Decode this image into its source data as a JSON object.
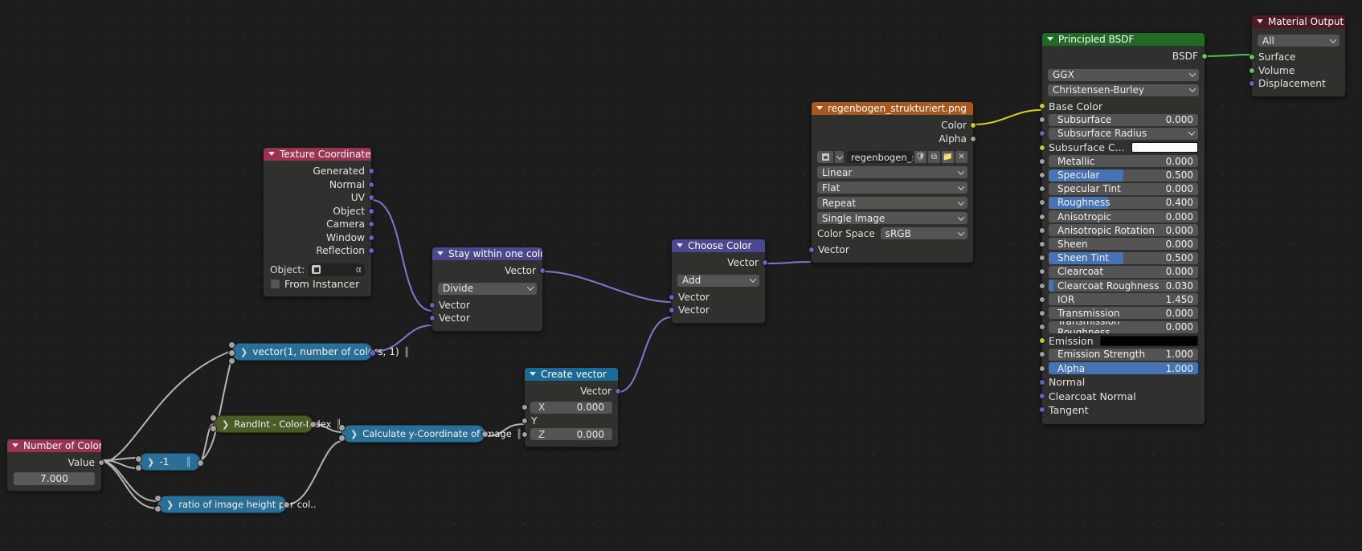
{
  "editor": {
    "name": "blender-shader-node-editor"
  },
  "nodes": {
    "texture_coordinate": {
      "title": "Texture Coordinate",
      "outputs": [
        "Generated",
        "Normal",
        "UV",
        "Object",
        "Camera",
        "Window",
        "Reflection"
      ],
      "object_label": "Object:",
      "object_value": "",
      "from_instancer_label": "From Instancer"
    },
    "stay_within_one_color": {
      "title": "Stay within one color",
      "output": "Vector",
      "operation": "Divide",
      "inputs": [
        "Vector",
        "Vector"
      ]
    },
    "choose_color": {
      "title": "Choose Color",
      "output": "Vector",
      "operation": "Add",
      "inputs": [
        "Vector",
        "Vector"
      ]
    },
    "create_vector": {
      "title": "Create vector",
      "output": "Vector",
      "fields": [
        {
          "axis": "X",
          "value": "0.000"
        },
        {
          "axis": "Z",
          "value": "0.000"
        }
      ],
      "y_label": "Y"
    },
    "image_texture": {
      "title": "regenbogen_strukturiert.png",
      "outputs": [
        "Color",
        "Alpha"
      ],
      "file_name": "regenbogen_str...",
      "buttons": [
        "shield-icon",
        "copy-icon",
        "folder-icon",
        "close-icon"
      ],
      "interpolation": "Linear",
      "projection": "Flat",
      "extension": "Repeat",
      "source": "Single Image",
      "color_space_label": "Color Space",
      "color_space_value": "sRGB",
      "input": "Vector"
    },
    "principled_bsdf": {
      "title": "Principled BSDF",
      "output": "BSDF",
      "distribution": "GGX",
      "subsurface_method": "Christensen-Burley",
      "rows": [
        {
          "label": "Base Color",
          "type": "socket",
          "socket": "yellow"
        },
        {
          "label": "Subsurface",
          "type": "slider",
          "socket": "grey",
          "value": "0.000",
          "fill": 0
        },
        {
          "label": "Subsurface Radius",
          "type": "dropdown",
          "socket": "purple",
          "value": ""
        },
        {
          "label": "Subsurface C...",
          "type": "color",
          "socket": "yellow",
          "color": "#ffffff"
        },
        {
          "label": "Metallic",
          "type": "slider",
          "socket": "grey",
          "value": "0.000",
          "fill": 0
        },
        {
          "label": "Specular",
          "type": "slider",
          "socket": "grey",
          "value": "0.500",
          "fill": 50
        },
        {
          "label": "Specular Tint",
          "type": "slider",
          "socket": "grey",
          "value": "0.000",
          "fill": 0
        },
        {
          "label": "Roughness",
          "type": "slider",
          "socket": "grey",
          "value": "0.400",
          "fill": 40
        },
        {
          "label": "Anisotropic",
          "type": "slider",
          "socket": "grey",
          "value": "0.000",
          "fill": 0
        },
        {
          "label": "Anisotropic Rotation",
          "type": "slider",
          "socket": "grey",
          "value": "0.000",
          "fill": 0
        },
        {
          "label": "Sheen",
          "type": "slider",
          "socket": "grey",
          "value": "0.000",
          "fill": 0
        },
        {
          "label": "Sheen Tint",
          "type": "slider",
          "socket": "grey",
          "value": "0.500",
          "fill": 50
        },
        {
          "label": "Clearcoat",
          "type": "slider",
          "socket": "grey",
          "value": "0.000",
          "fill": 0
        },
        {
          "label": "Clearcoat Roughness",
          "type": "slider",
          "socket": "grey",
          "value": "0.030",
          "fill": 3
        },
        {
          "label": "IOR",
          "type": "slider",
          "socket": "grey",
          "value": "1.450",
          "fill": 0
        },
        {
          "label": "Transmission",
          "type": "slider",
          "socket": "grey",
          "value": "0.000",
          "fill": 0
        },
        {
          "label": "Transmission Roughness",
          "type": "slider",
          "socket": "grey",
          "value": "0.000",
          "fill": 0
        },
        {
          "label": "Emission",
          "type": "color",
          "socket": "yellow",
          "color": "#000000"
        },
        {
          "label": "Emission Strength",
          "type": "slider",
          "socket": "grey",
          "value": "1.000",
          "fill": 0
        },
        {
          "label": "Alpha",
          "type": "slider",
          "socket": "grey",
          "value": "1.000",
          "fill": 100
        },
        {
          "label": "Normal",
          "type": "socket",
          "socket": "purple"
        },
        {
          "label": "Clearcoat Normal",
          "type": "socket",
          "socket": "purple"
        },
        {
          "label": "Tangent",
          "type": "socket",
          "socket": "purple"
        }
      ]
    },
    "material_output": {
      "title": "Material Output",
      "target": "All",
      "inputs": [
        {
          "label": "Surface",
          "socket": "green"
        },
        {
          "label": "Volume",
          "socket": "green"
        },
        {
          "label": "Displacement",
          "socket": "purple"
        }
      ]
    },
    "number_of_colors": {
      "title": "Number of Colors",
      "output": "Value",
      "value": "7.000"
    },
    "pill_minus_one": {
      "label": "-1"
    },
    "pill_vector": {
      "label": "vector(1, number of colors, 1)"
    },
    "pill_randint": {
      "label": "RandInt - Color-Index"
    },
    "pill_calc_y": {
      "label": "Calculate y-Coordinate of Image"
    },
    "pill_ratio": {
      "label": "ratio of image height per col.."
    }
  },
  "colors": {
    "header_pink": "#9a3251",
    "header_darkred": "#4b1a25",
    "header_green": "#1f6a25",
    "header_orange": "#a8581f",
    "header_violet": "#4b4890",
    "header_blue": "#1a6a95",
    "socket_yellow": "#c7c729",
    "socket_purple": "#6363c7",
    "socket_green": "#5ec65e",
    "socket_grey": "#a1a1a1",
    "slider_fill": "#4772b3",
    "wire_grey": "#b5b5b5",
    "wire_purple": "#7a7ad0",
    "wire_yellow": "#d6d61e",
    "wire_green": "#4fc24f"
  }
}
